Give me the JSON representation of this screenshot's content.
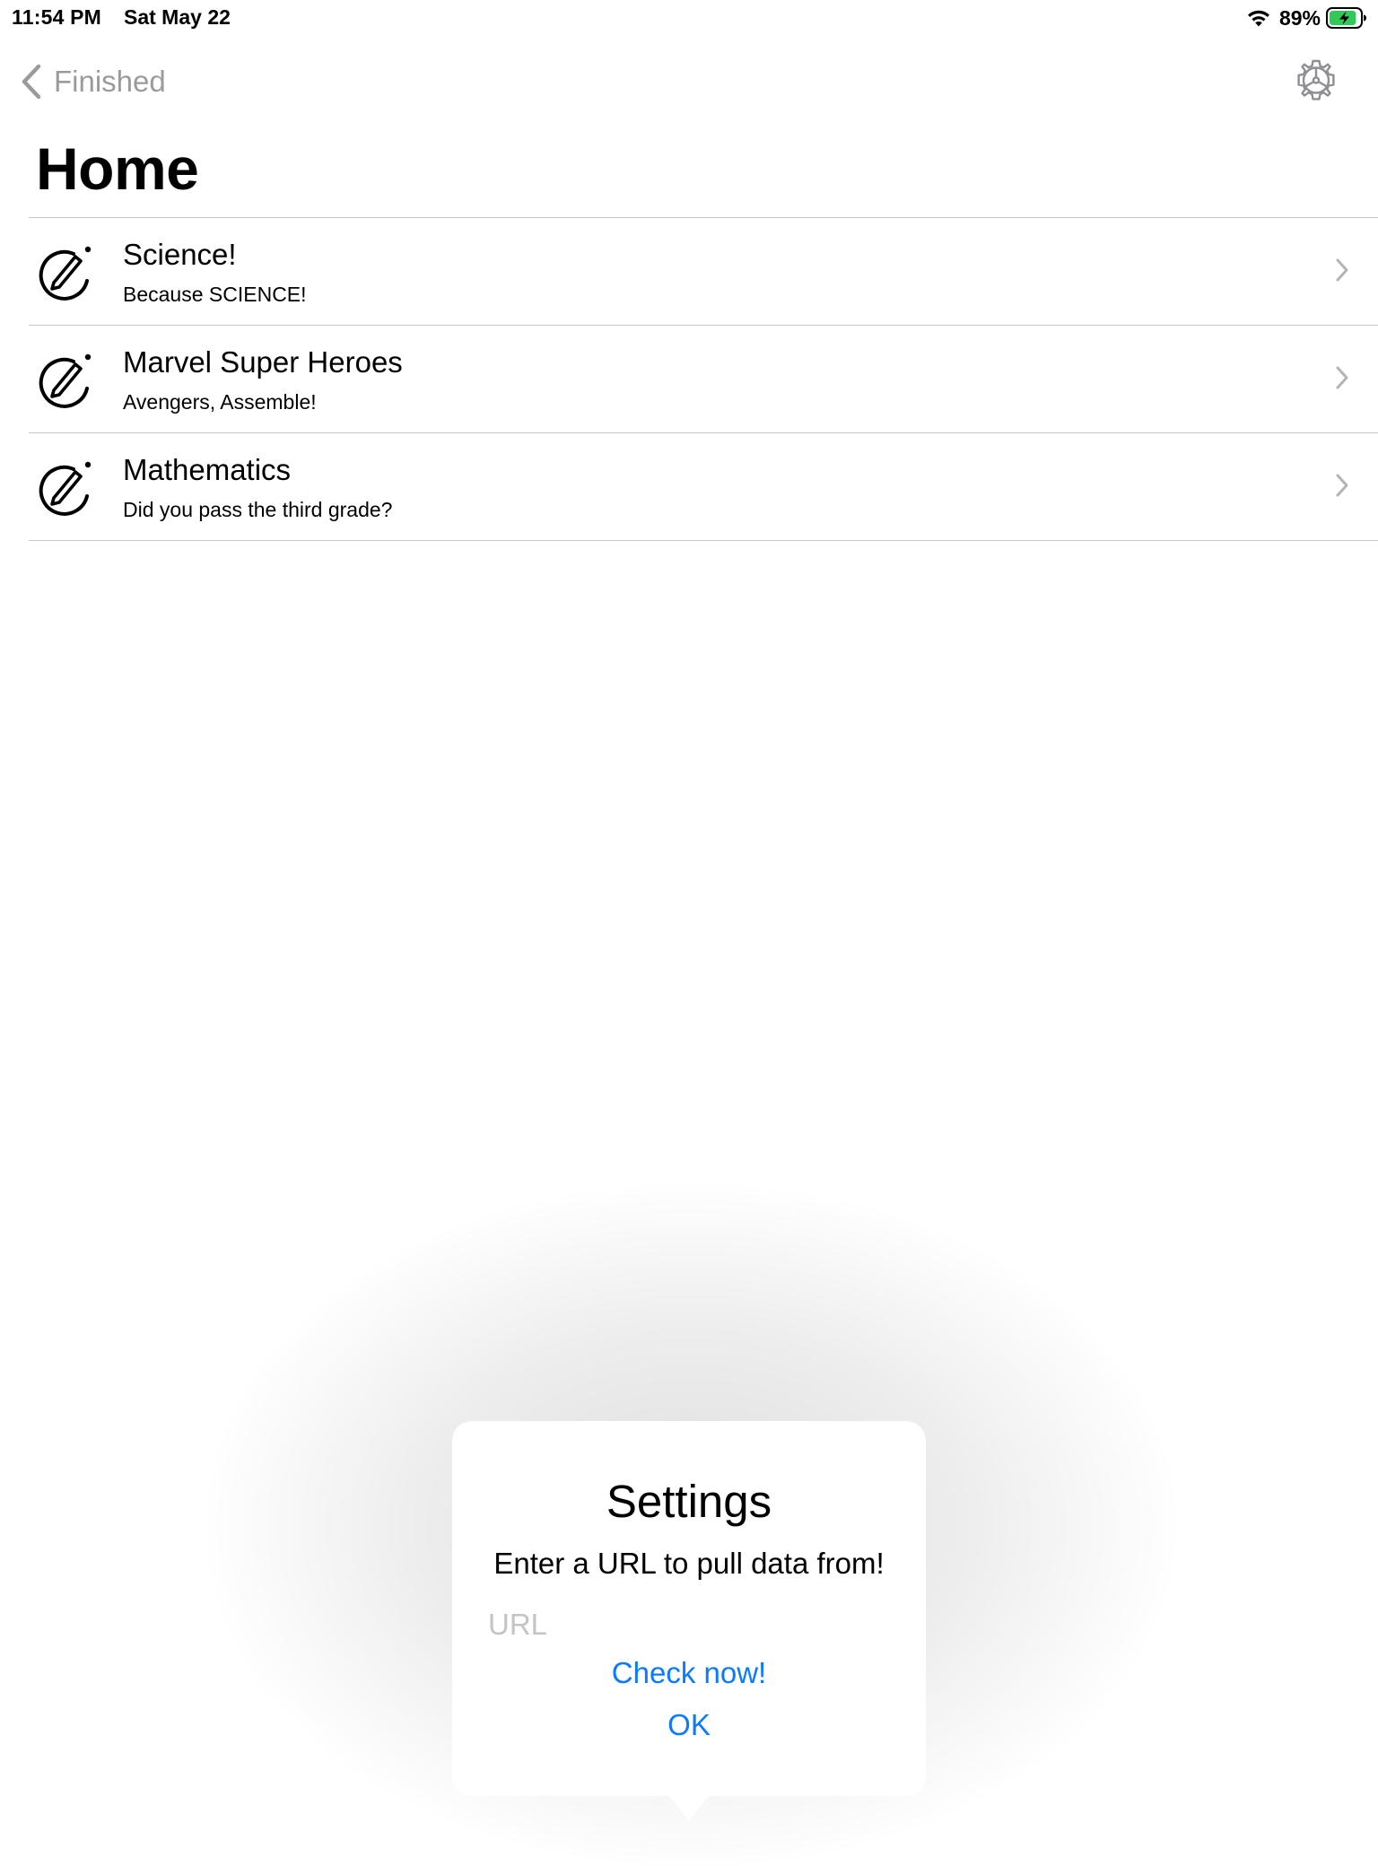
{
  "status_bar": {
    "time": "11:54 PM",
    "date": "Sat May 22",
    "battery_percent": "89%",
    "battery_level": 0.89,
    "battery_charging": true,
    "battery_color": "#34c759"
  },
  "nav": {
    "back_label": "Finished",
    "back_icon": "chevron-left-icon",
    "settings_icon": "gear-icon"
  },
  "page": {
    "title": "Home"
  },
  "topics": [
    {
      "title": "Science!",
      "subtitle": "Because SCIENCE!",
      "icon": "pencil-circle-icon"
    },
    {
      "title": "Marvel Super Heroes",
      "subtitle": "Avengers, Assemble!",
      "icon": "pencil-circle-icon"
    },
    {
      "title": "Mathematics",
      "subtitle": "Did you pass the third grade?",
      "icon": "pencil-circle-icon"
    }
  ],
  "popover": {
    "title": "Settings",
    "message": "Enter a URL to pull data from!",
    "url_placeholder": "URL",
    "url_value": "",
    "check_now_label": "Check now!",
    "ok_label": "OK",
    "link_color": "#0a7aff"
  }
}
